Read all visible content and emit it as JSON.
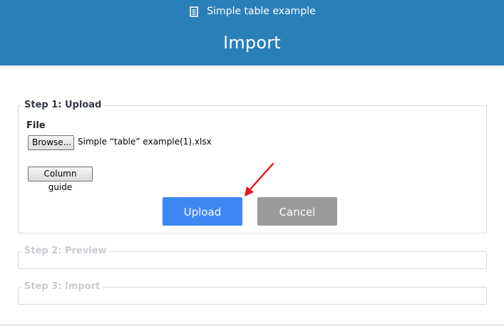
{
  "header": {
    "doc_icon": "document-icon",
    "doc_title": "Simple table example",
    "page_title": "Import"
  },
  "steps": {
    "upload": {
      "legend": "Step 1: Upload",
      "file_label": "File",
      "browse_label": "Browse...",
      "file_name": "Simple “table” example(1).xlsx",
      "column_guide_label": "Column guide",
      "upload_label": "Upload",
      "cancel_label": "Cancel"
    },
    "preview": {
      "legend": "Step 2: Preview"
    },
    "import": {
      "legend": "Step 3: Import"
    }
  },
  "annotation": {
    "arrow": "red-arrow-icon",
    "color": "#e3161b"
  },
  "colors": {
    "header_bg": "#2a7fb9",
    "upload_button": "#3f87f5",
    "cancel_button": "#9a9a9a"
  }
}
